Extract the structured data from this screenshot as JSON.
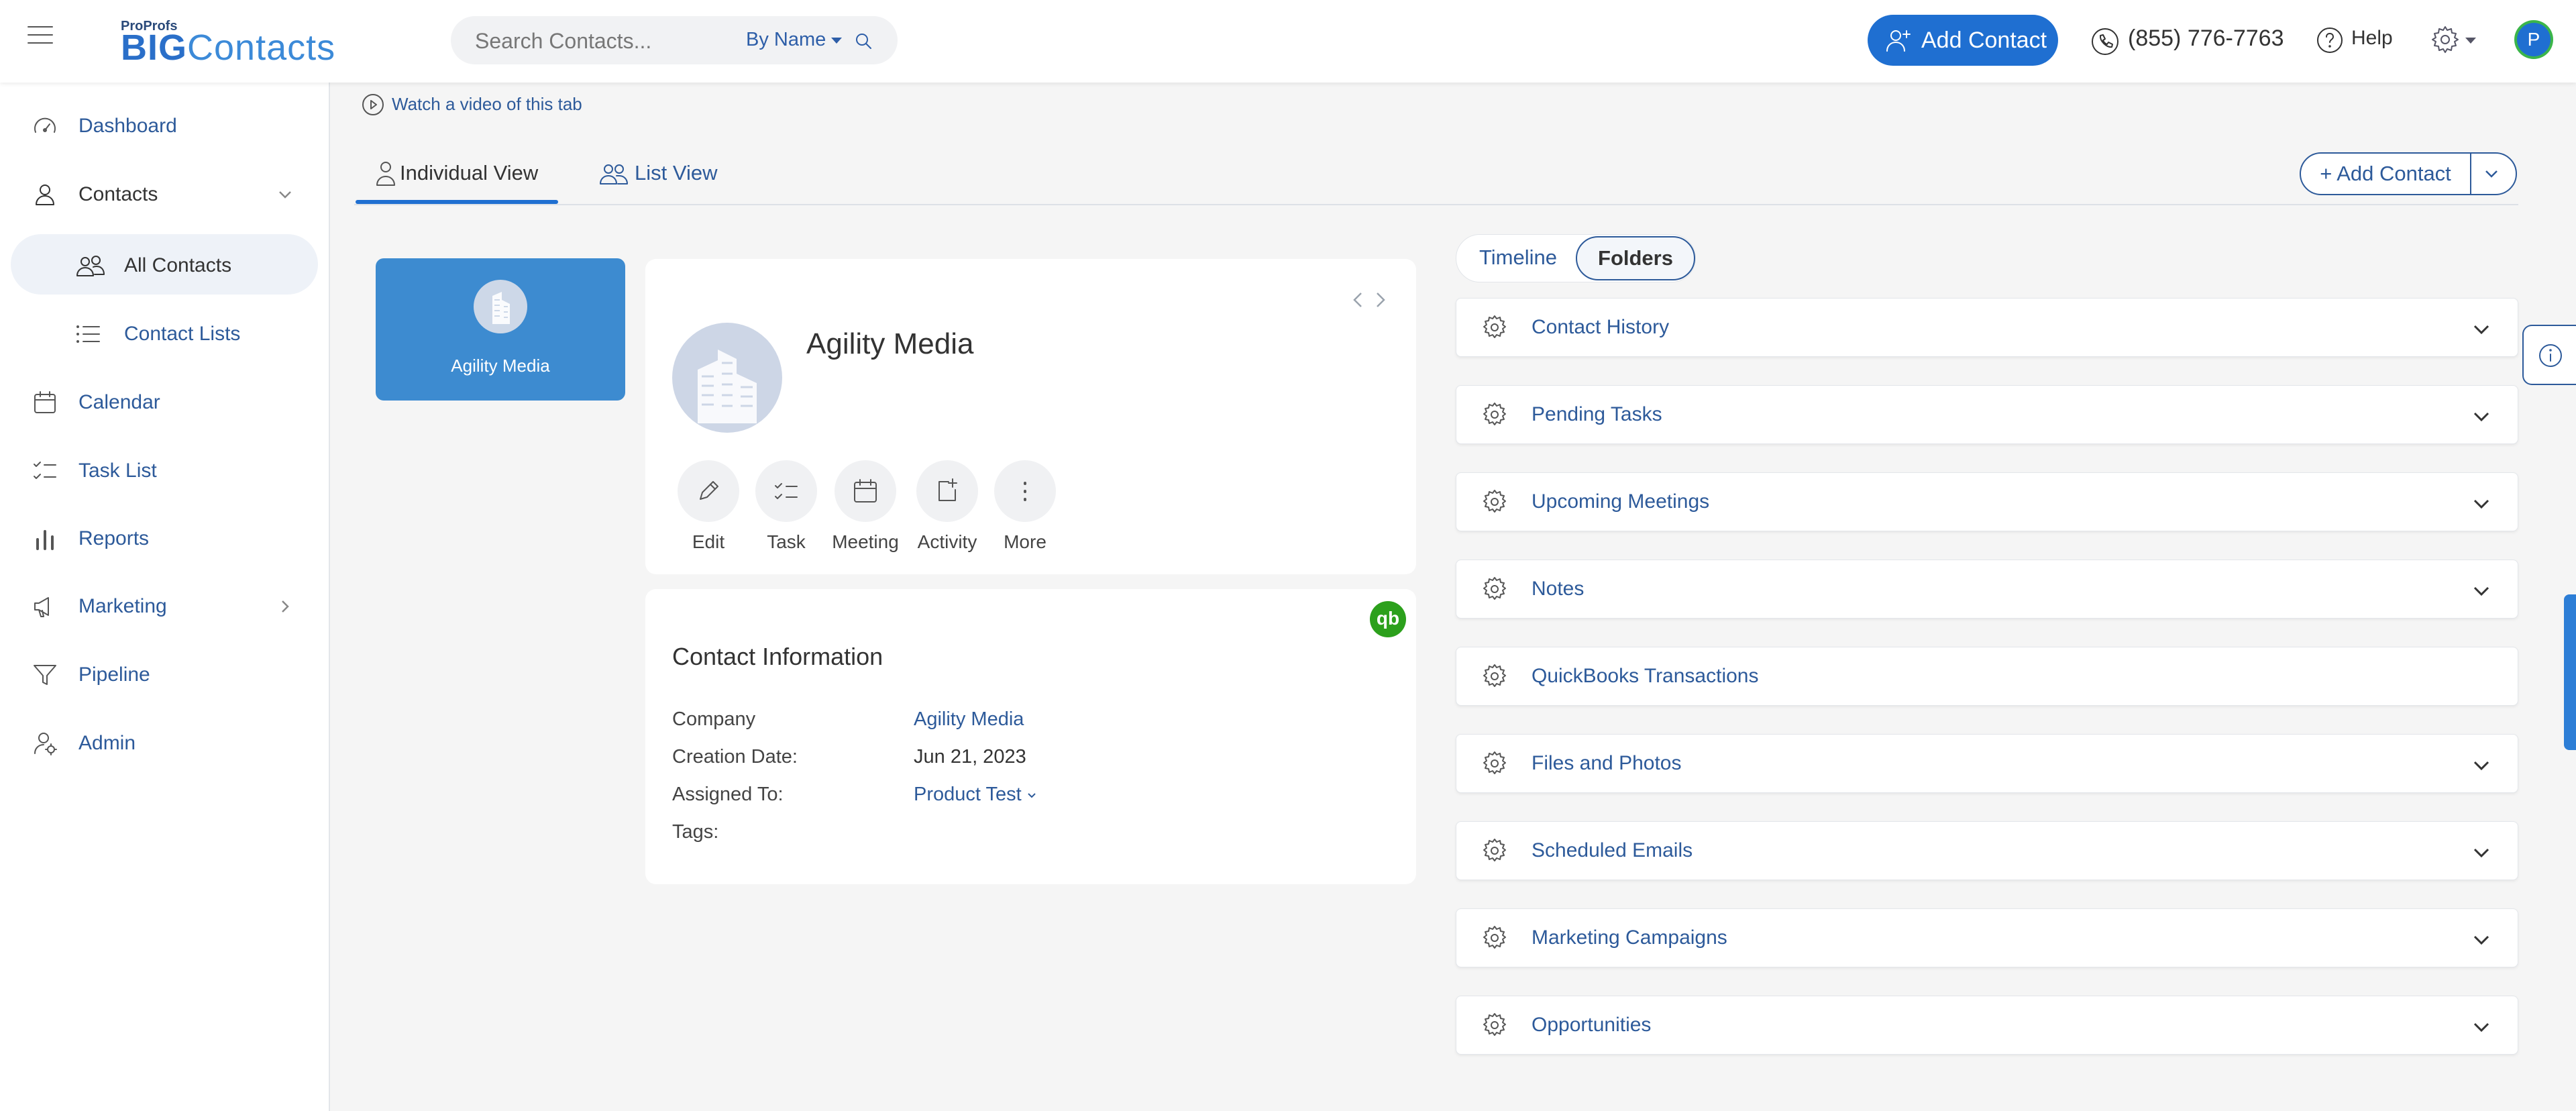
{
  "header": {
    "logo_prefix": "ProProfs",
    "logo_big": "BIG",
    "logo_rest": "Contacts",
    "search_placeholder": "Search Contacts...",
    "search_by": "By Name",
    "add_contact_label": "Add Contact",
    "phone": "(855) 776-7763",
    "help_label": "Help",
    "avatar_initial": "P"
  },
  "sidebar": {
    "items": [
      {
        "label": "Dashboard",
        "icon": "gauge-icon"
      },
      {
        "label": "Contacts",
        "icon": "user-icon"
      },
      {
        "label": "All Contacts",
        "icon": "users-icon"
      },
      {
        "label": "Contact Lists",
        "icon": "list-icon"
      },
      {
        "label": "Calendar",
        "icon": "calendar-icon"
      },
      {
        "label": "Task List",
        "icon": "checklist-icon"
      },
      {
        "label": "Reports",
        "icon": "bar-chart-icon"
      },
      {
        "label": "Marketing",
        "icon": "megaphone-icon"
      },
      {
        "label": "Pipeline",
        "icon": "funnel-icon"
      },
      {
        "label": "Admin",
        "icon": "admin-icon"
      }
    ]
  },
  "main": {
    "watch_video": "Watch a video of this tab",
    "tabs": [
      {
        "label": "Individual View"
      },
      {
        "label": "List View"
      }
    ],
    "add_contact_split": "+ Add Contact"
  },
  "contact": {
    "name": "Agility Media",
    "actions": [
      {
        "label": "Edit",
        "icon": "pencil-icon"
      },
      {
        "label": "Task",
        "icon": "task-icon"
      },
      {
        "label": "Meeting",
        "icon": "calendar-icon"
      },
      {
        "label": "Activity",
        "icon": "activity-icon"
      },
      {
        "label": "More",
        "icon": "more-vertical-icon"
      }
    ],
    "info_title": "Contact Information",
    "qb_badge": "qb",
    "info": [
      {
        "key": "Company",
        "value": "Agility Media"
      },
      {
        "key": "Creation Date:",
        "value": "Jun 21, 2023"
      },
      {
        "key": "Assigned To:",
        "value": "Product Test"
      },
      {
        "key": "Tags:",
        "value": ""
      }
    ]
  },
  "right": {
    "toggle": [
      "Timeline",
      "Folders"
    ],
    "sections": [
      {
        "label": "Contact History"
      },
      {
        "label": "Pending Tasks"
      },
      {
        "label": "Upcoming Meetings"
      },
      {
        "label": "Notes"
      },
      {
        "label": "QuickBooks Transactions"
      },
      {
        "label": "Files and Photos"
      },
      {
        "label": "Scheduled Emails"
      },
      {
        "label": "Marketing Campaigns"
      },
      {
        "label": "Opportunities"
      }
    ]
  },
  "colors": {
    "primary": "#1f6fd1",
    "link": "#2d5a9a",
    "card_blue": "#3d8bd0",
    "quickbooks_green": "#2ca01c"
  }
}
